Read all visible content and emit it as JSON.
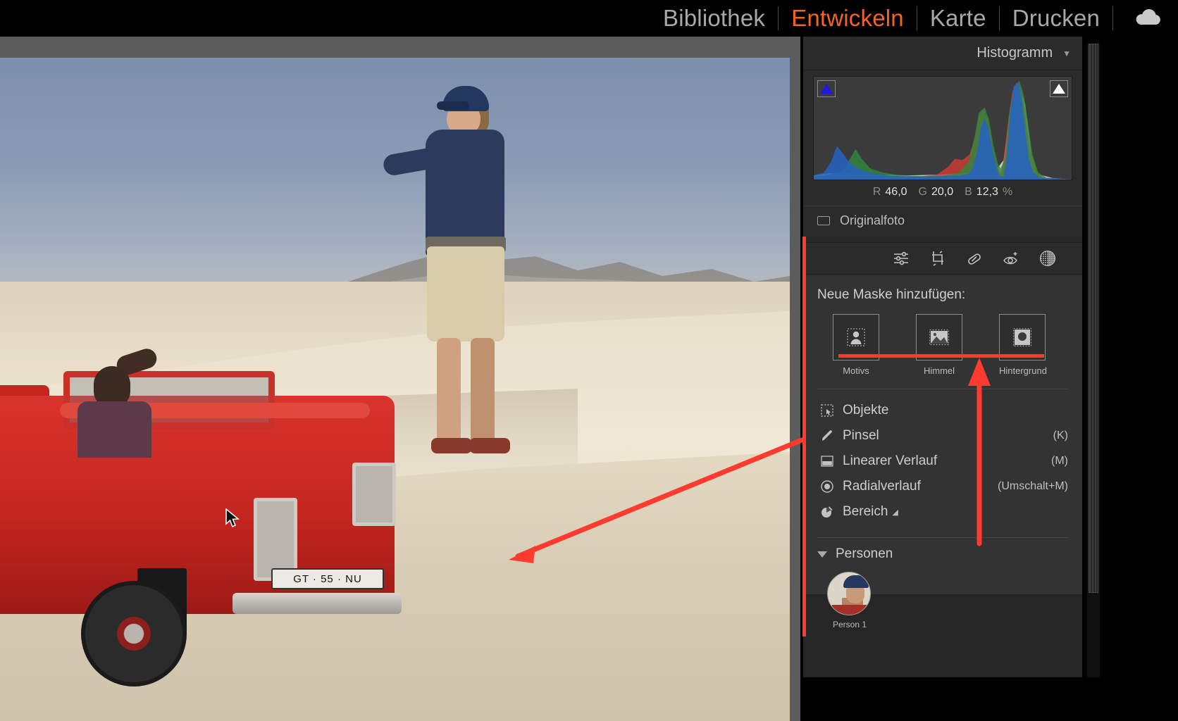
{
  "app": {
    "modules": [
      {
        "label": "Bibliothek",
        "active": false
      },
      {
        "label": "Entwickeln",
        "active": true
      },
      {
        "label": "Karte",
        "active": false
      },
      {
        "label": "Drucken",
        "active": false
      }
    ],
    "cloud_icon": "cloud-icon",
    "accent_color": "#f26522",
    "annotation_color": "#ff3b30"
  },
  "histogram": {
    "title": "Histogramm",
    "caret": "▼",
    "clip_left_icon": "shadow-clipping-triangle-blue",
    "clip_right_icon": "highlight-clipping-triangle-white",
    "readout": {
      "r_label": "R",
      "r_value": "46,0",
      "g_label": "G",
      "g_value": "20,0",
      "b_label": "B",
      "b_value": "12,3",
      "unit": "%"
    },
    "original_photo_label": "Originalfoto"
  },
  "tool_strip": [
    {
      "name": "basic-adjustments-icon",
      "glyph": "sliders"
    },
    {
      "name": "crop-overlay-icon",
      "glyph": "crop"
    },
    {
      "name": "healing-brush-icon",
      "glyph": "bandage"
    },
    {
      "name": "red-eye-correction-icon",
      "glyph": "eye"
    },
    {
      "name": "masking-icon",
      "glyph": "dotted-circle"
    }
  ],
  "mask_panel": {
    "title": "Neue Maske hinzufügen:",
    "thumbs": [
      {
        "label": "Motivs",
        "icon": "subject-person-icon"
      },
      {
        "label": "Himmel",
        "icon": "sky-landscape-icon"
      },
      {
        "label": "Hintergrund",
        "icon": "background-icon"
      }
    ],
    "items": [
      {
        "label": "Objekte",
        "shortcut": "",
        "icon": "objects-select-icon"
      },
      {
        "label": "Pinsel",
        "shortcut": "(K)",
        "icon": "brush-icon"
      },
      {
        "label": "Linearer Verlauf",
        "shortcut": "(M)",
        "icon": "linear-gradient-icon"
      },
      {
        "label": "Radialverlauf",
        "shortcut": "(Umschalt+M)",
        "icon": "radial-gradient-icon"
      },
      {
        "label": "Bereich",
        "shortcut": "",
        "icon": "color-range-icon",
        "submenu": "◢"
      }
    ],
    "people_section": {
      "label": "Personen",
      "expanded_icon": "triangle-down-icon",
      "people": [
        {
          "label": "Person 1",
          "avatar": "person-1-avatar"
        }
      ]
    }
  },
  "photo": {
    "description": "desert-dune-with-red-pickup-truck-and-two-people",
    "license_plate": "GT · 55 · NU",
    "cursor": "mouse-pointer"
  }
}
